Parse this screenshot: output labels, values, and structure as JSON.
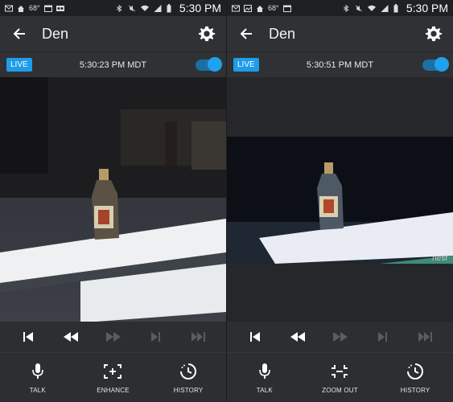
{
  "status_bar": {
    "temperature": "68°",
    "time": "5:30 PM",
    "left_icons": [
      "mail-icon",
      "home-icon",
      "calendar-icon",
      "voicemail-icon"
    ],
    "right_icons": [
      "bluetooth-icon",
      "mute-icon",
      "wifi-icon",
      "signal-icon",
      "battery-icon"
    ]
  },
  "panels": [
    {
      "camera_name": "Den",
      "live_label": "LIVE",
      "timestamp": "5:30:23 PM MDT",
      "live_toggle_on": true,
      "actions": [
        {
          "label": "TALK",
          "icon": "microphone-icon"
        },
        {
          "label": "ENHANCE",
          "icon": "enhance-icon"
        },
        {
          "label": "HISTORY",
          "icon": "history-icon"
        }
      ]
    },
    {
      "camera_name": "Den",
      "live_label": "LIVE",
      "timestamp": "5:30:51 PM MDT",
      "live_toggle_on": true,
      "watermark": "nest",
      "actions": [
        {
          "label": "TALK",
          "icon": "microphone-icon"
        },
        {
          "label": "ZOOM OUT",
          "icon": "zoom-out-icon"
        },
        {
          "label": "HISTORY",
          "icon": "history-icon"
        }
      ]
    }
  ],
  "colors": {
    "accent": "#1e9be9",
    "background": "#2c2e31",
    "disabled_control": "#5a5c60"
  }
}
